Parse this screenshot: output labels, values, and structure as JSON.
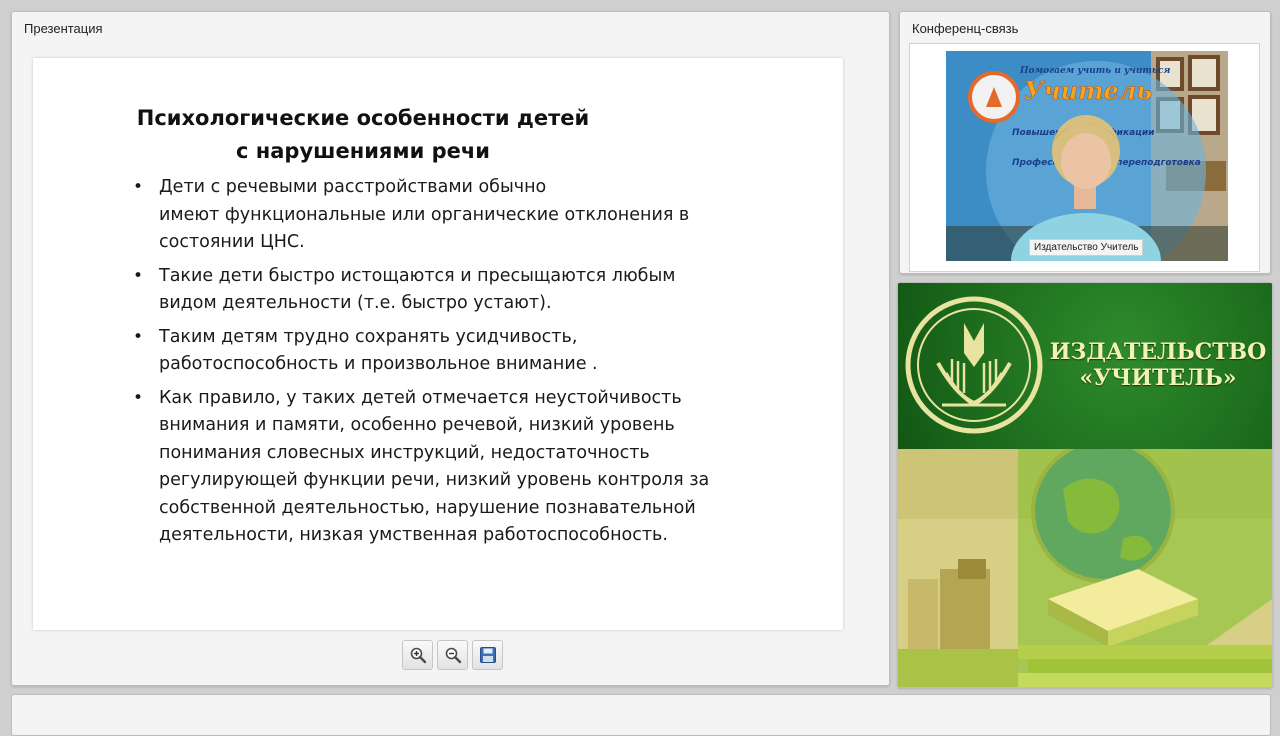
{
  "presentation": {
    "panel_title": "Презентация",
    "slide": {
      "title_line1": "Психологические особенности детей",
      "title_line2": "с нарушениями речи",
      "bullets": [
        [
          "Дети с речевыми расстройствами обычно",
          "имеют функциональные или органические отклонения в",
          "состоянии ЦНС."
        ],
        [
          "Такие дети быстро истощаются и пресыщаются любым",
          "видом деятельности (т.е. быстро устают)."
        ],
        [
          "Таким детям трудно сохранять усидчивость,",
          "работоспособность и произвольное внимание ."
        ],
        [
          "Как правило, у таких детей отмечается неустойчивость",
          "внимания и памяти, особенно речевой, низкий уровень",
          "понимания словесных инструкций, недостаточность",
          "регулирующей функции речи, низкий уровень контроля за",
          "собственной деятельностью, нарушение познавательной",
          "деятельности, низкая умственная работоспособность."
        ]
      ]
    },
    "toolbar": {
      "zoom_in_icon": "zoom-in-icon",
      "zoom_out_icon": "zoom-out-icon",
      "save_icon": "save-icon"
    }
  },
  "conference": {
    "panel_title": "Конференц-связь",
    "video_caption": "Издательство Учитель",
    "banner": {
      "brand_line": "Учитель",
      "tagline": "Помогаем учить и учиться",
      "bullets": [
        "Повышение квалификации",
        "Профессиональная переподготовка"
      ]
    }
  },
  "brand": {
    "line1": "ИЗДАТЕЛЬСТВО",
    "line2": "«УЧИТЕЛЬ»",
    "colors": {
      "green": "#1a681b",
      "gold": "#e9e3a0"
    }
  }
}
